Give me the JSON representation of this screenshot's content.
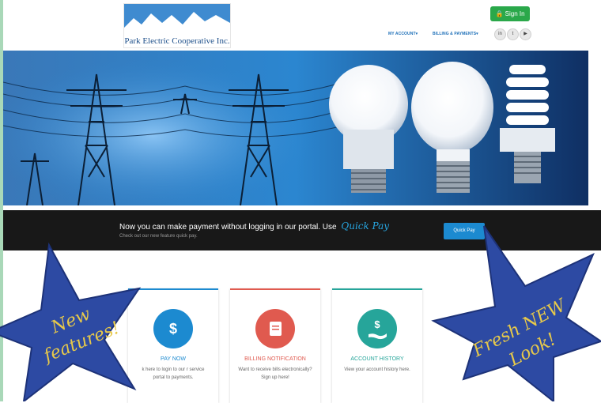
{
  "header": {
    "logo_text": "Park Electric Cooperative Inc.",
    "signin_label": "Sign In",
    "nav": {
      "my_account": "MY ACCOUNT",
      "billing": "BILLING & PAYMENTS"
    },
    "social": [
      "linkedin-icon",
      "twitter-icon",
      "youtube-icon"
    ]
  },
  "banner": {
    "message": "Now you can make payment without logging in our portal. Use",
    "highlight": "Quick Pay",
    "subtext": "Check out our new feature quick pay.",
    "button": "Quick Pay"
  },
  "cards": [
    {
      "title": "PAY NOW",
      "description": "k here to login to our r service portal to payments.",
      "color": "#1c8ad0",
      "icon": "dollar-icon"
    },
    {
      "title": "BILLING NOTIFICATION",
      "description": "Want to receive bills electronically? Sign up here!",
      "color": "#e05a4f",
      "icon": "book-icon"
    },
    {
      "title": "ACCOUNT HISTORY",
      "description": "View your account history here.",
      "color": "#26a59a",
      "icon": "hand-dollar-icon"
    }
  ],
  "stars": {
    "left": [
      "New",
      "features!"
    ],
    "right": [
      "Fresh NEW",
      "Look!"
    ],
    "fill": "#2d4aa3",
    "text_color": "#e7c94a"
  }
}
